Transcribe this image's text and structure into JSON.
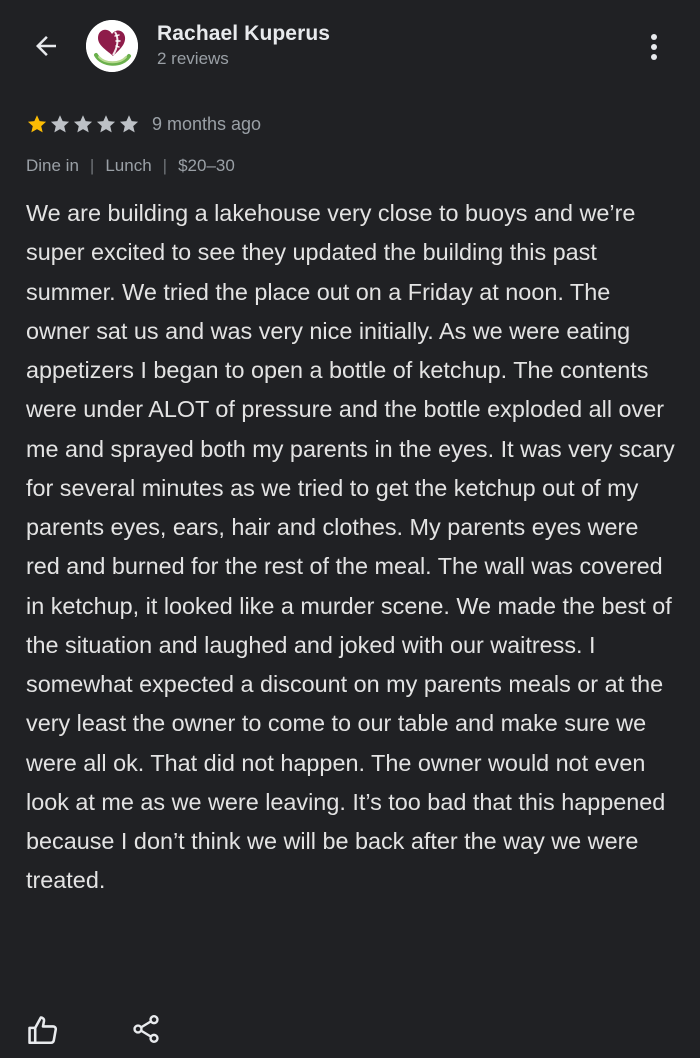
{
  "header": {
    "back_icon": "arrow-back-icon",
    "reviewer_name": "Rachael Kuperus",
    "review_count": "2 reviews",
    "more_icon": "more-vertical-icon"
  },
  "rating": {
    "stars_filled": 1,
    "stars_total": 5,
    "star_filled_color": "#fbbc04",
    "star_empty_color": "#bdc1c6",
    "date": "9 months ago"
  },
  "meta": {
    "tags": [
      "Dine in",
      "Lunch",
      "$20–30"
    ],
    "separator": "|"
  },
  "review": {
    "text": "We are building a lakehouse very close to buoys and we’re super excited to see they updated the building this past summer. We tried the place out on a Friday at noon. The owner sat us and was very nice initially. As we were eating appetizers I began to open a bottle of ketchup. The contents were under ALOT of pressure and the bottle exploded all over me and sprayed both my parents in the eyes. It was very scary for several minutes as we tried to get the ketchup out of my parents eyes, ears, hair and clothes. My parents eyes were red and burned for the rest of the meal. The wall was covered in ketchup, it looked like a murder scene. We made the best of the situation and laughed and joked with our waitress. I somewhat expected a discount on my parents meals or at the very least the owner to come to our table and make sure we were all ok. That did not happen. The owner would not even look at me as we were leaving. It’s too bad that this happened because I don’t think we will be back after the way we were treated."
  },
  "actions": {
    "like_icon": "thumbs-up-icon",
    "share_icon": "share-icon"
  },
  "colors": {
    "background": "#202124",
    "text_primary": "#e8eaed",
    "text_secondary": "#9aa0a6",
    "avatar_purple": "#8e1c4a",
    "avatar_green": "#6ab04c"
  }
}
